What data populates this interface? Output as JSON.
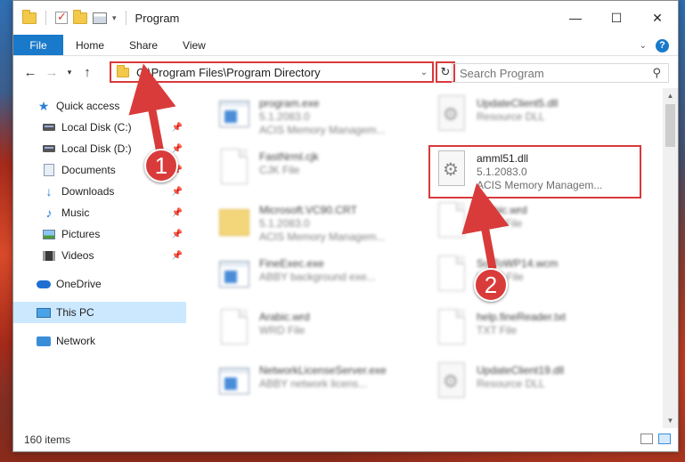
{
  "window": {
    "title": "Program",
    "controls": {
      "minimize": "—",
      "maximize": "☐",
      "close": "✕"
    }
  },
  "ribbon": {
    "tabs": [
      "File",
      "Home",
      "Share",
      "View"
    ],
    "help": "?"
  },
  "address": {
    "path": "C:\\Program Files\\Program Directory",
    "search_placeholder": "Search Program"
  },
  "sidebar": {
    "items": [
      {
        "label": "Quick access",
        "icon": "star-icon",
        "pinned": false
      },
      {
        "label": "Local Disk (C:)",
        "icon": "disk-icon",
        "pinned": true
      },
      {
        "label": "Local Disk (D:)",
        "icon": "disk-icon",
        "pinned": true
      },
      {
        "label": "Documents",
        "icon": "documents-icon",
        "pinned": true
      },
      {
        "label": "Downloads",
        "icon": "downloads-icon",
        "pinned": true
      },
      {
        "label": "Music",
        "icon": "music-icon",
        "pinned": true
      },
      {
        "label": "Pictures",
        "icon": "pictures-icon",
        "pinned": true
      },
      {
        "label": "Videos",
        "icon": "videos-icon",
        "pinned": true
      },
      {
        "label": "OneDrive",
        "icon": "onedrive-icon",
        "pinned": false
      },
      {
        "label": "This PC",
        "icon": "this-pc-icon",
        "pinned": false,
        "selected": true
      },
      {
        "label": "Network",
        "icon": "network-icon",
        "pinned": false
      }
    ]
  },
  "files": [
    {
      "name": "program.exe",
      "line1": "5.1.2083.0",
      "line2": "ACIS Memory Managem...",
      "icon": "exe-icon"
    },
    {
      "name": "UpdateClient5.dll",
      "line1": "Resource DLL",
      "line2": "",
      "icon": "dll-icon"
    },
    {
      "name": "FastNrml.cjk",
      "line1": "CJK File",
      "line2": "",
      "icon": "blank-file-icon"
    },
    {
      "name": "amml51.dll",
      "line1": "5.1.2083.0",
      "line2": "ACIS Memory Managem...",
      "icon": "dll-icon",
      "highlighted": true
    },
    {
      "name": "Microsoft.VC90.CRT",
      "line1": "5.1.2083.0",
      "line2": "ACIS Memory Managem...",
      "icon": "folder-icon"
    },
    {
      "name": "Arabic.wrd",
      "line1": "WRD File",
      "line2": "",
      "icon": "blank-file-icon"
    },
    {
      "name": "FineExec.exe",
      "line1": "ABBY background exe...",
      "line2": "",
      "icon": "exe-icon"
    },
    {
      "name": "SofToWP14.wcm",
      "line1": "WCM File",
      "line2": "",
      "icon": "blank-file-icon"
    },
    {
      "name": "Arabic.wrd",
      "line1": "WRD File",
      "line2": "",
      "icon": "blank-file-icon"
    },
    {
      "name": "help.fineReader.txt",
      "line1": "TXT File",
      "line2": "",
      "icon": "blank-file-icon"
    },
    {
      "name": "NetworkLicenseServer.exe",
      "line1": "ABBY network licens...",
      "line2": "",
      "icon": "exe-icon"
    },
    {
      "name": "UpdateClient19.dll",
      "line1": "Resource DLL",
      "line2": "",
      "icon": "dll-icon"
    }
  ],
  "status": {
    "count": "160 items"
  },
  "annotations": {
    "step1": "1",
    "step2": "2",
    "color": "#d93b3b"
  }
}
